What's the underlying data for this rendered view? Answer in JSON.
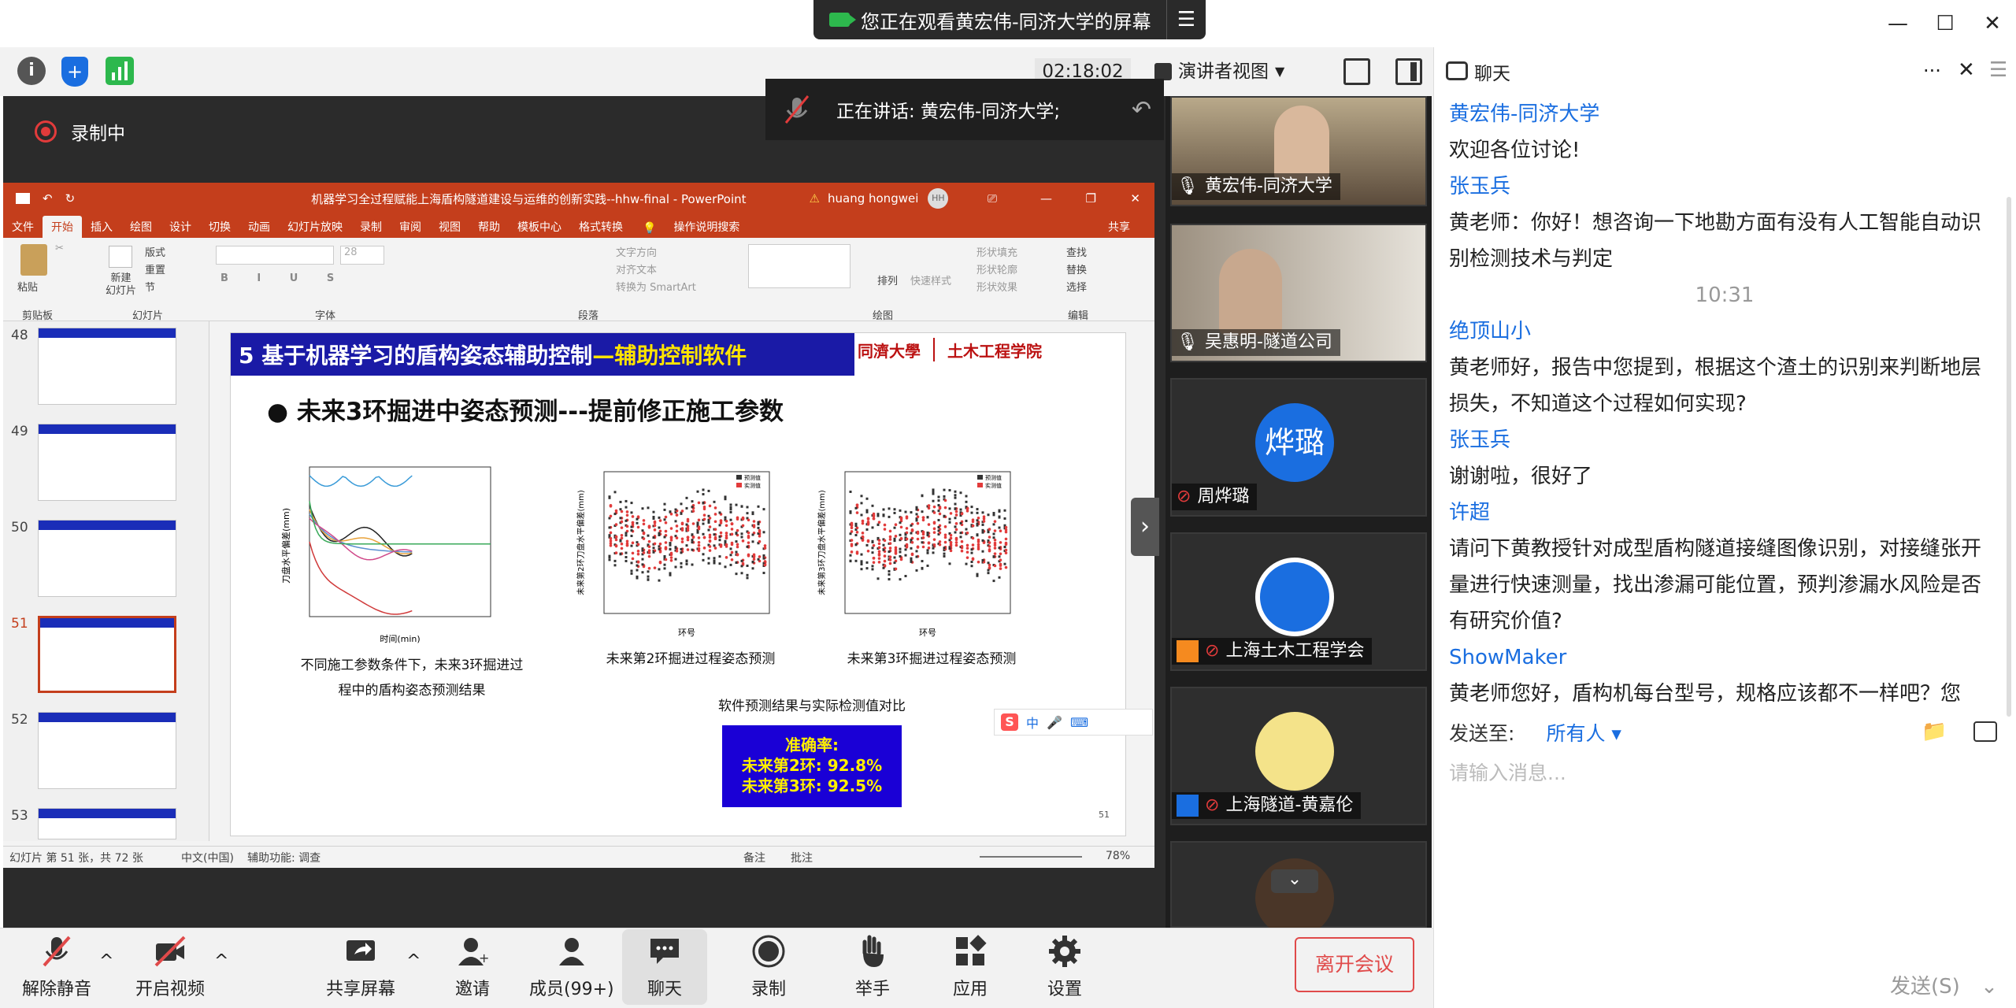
{
  "colors": {
    "accent": "#1a6ee0",
    "leave": "#e04a4a",
    "recording": "#e23b3b",
    "ppt_red": "#c43e1c",
    "slide_blue": "#1a1aa6",
    "highlight": "#ffe400"
  },
  "titlebar": {
    "share_notice": "您正在观看黄宏伟-同济大学的屏幕",
    "menu_icon": "menu-icon"
  },
  "toolbar": {
    "timer": "02:18:02",
    "presenter_view": "演讲者视图"
  },
  "stage": {
    "recording": "录制中",
    "speaking": "正在讲话: 黄宏伟-同济大学;"
  },
  "ppt": {
    "title": "机器学习全过程赋能上海盾构隧道建设与运维的创新实践--hhw-final  -  PowerPoint",
    "user": "huang hongwei",
    "user_initials": "HH",
    "warning": "⚠",
    "tabs": [
      "文件",
      "开始",
      "插入",
      "绘图",
      "设计",
      "切换",
      "动画",
      "幻灯片放映",
      "录制",
      "审阅",
      "视图",
      "帮助",
      "模板中心",
      "格式转换"
    ],
    "tell_me": "操作说明搜索",
    "share": "共享",
    "ribbon_groups": [
      "剪贴板",
      "幻灯片",
      "字体",
      "段落",
      "绘图",
      "编辑"
    ],
    "ribbon_items": {
      "paste": "粘贴",
      "new_slide": "新建\n幻灯片",
      "layout": "版式",
      "reset": "重置",
      "section": "节",
      "font_size": "28",
      "text_dir": "文字方向",
      "align_text": "对齐文本",
      "smartart": "转换为 SmartArt",
      "arrange": "排列",
      "quick_styles": "快速样式",
      "shape_fill": "形状填充",
      "shape_outline": "形状轮廓",
      "shape_effect": "形状效果",
      "find": "查找",
      "replace": "替换",
      "select": "选择"
    },
    "thumb_numbers": [
      "48",
      "49",
      "50",
      "51",
      "52",
      "53"
    ],
    "status": {
      "slide_info": "幻灯片 第 51 张，共 72 张",
      "lang": "中文(中国)",
      "accessibility": "辅助功能: 调查",
      "notes": "备注",
      "comments": "批注",
      "zoom": "78%"
    }
  },
  "slide": {
    "heading_main": "5 基于机器学习的盾构姿态辅助控制",
    "heading_sub": "—辅助控制软件",
    "logo_tongji": "同濟大學",
    "logo_civil": "土木工程学院",
    "bullet": "● 未来3环掘进中姿态预测---提前修正施工参数",
    "caption1": "不同施工参数条件下，未来3环掘进过\n程中的盾构姿态预测结果",
    "caption2": "未来第2环掘进过程姿态预测",
    "caption3": "未来第3环掘进过程姿态预测",
    "compare_title": "软件预测结果与实际检测值对比",
    "accuracy_title": "准确率:",
    "accuracy_ring2": "未来第2环:  92.8%",
    "accuracy_ring3": "未来第3环:  92.5%",
    "page": "51"
  },
  "chart_data": [
    {
      "type": "line",
      "xlabel": "时间(min)",
      "ylabel": "刀盘水平偏差(mm)",
      "xlim": [
        0,
        300
      ],
      "ylim": [
        -3,
        4
      ]
    },
    {
      "type": "scatter",
      "xlabel": "环号",
      "ylabel": "未来第2环刀盘水平偏差(mm)",
      "legend": [
        "预测值",
        "实测值"
      ],
      "xlim": [
        100,
        130
      ],
      "ylim": [
        -20,
        25
      ]
    },
    {
      "type": "scatter",
      "xlabel": "环号",
      "ylabel": "未来第3环刀盘水平偏差(mm)",
      "legend": [
        "预测值",
        "实测值"
      ],
      "xlim": [
        100,
        130
      ],
      "ylim": [
        -20,
        25
      ]
    }
  ],
  "participants": [
    {
      "name": "黄宏伟-同济大学",
      "mic": "mic-icon"
    },
    {
      "name": "吴惠明-隧道公司",
      "mic": "mic-icon"
    },
    {
      "name": "周烨璐",
      "avatar_text": "烨璐",
      "mic": "mic-muted-icon"
    },
    {
      "name": "上海土木工程学会",
      "mic": "mic-muted-icon"
    },
    {
      "name": "上海隧道-黄嘉伦",
      "mic": "mic-muted-icon"
    }
  ],
  "chat": {
    "title": "聊天",
    "messages": [
      {
        "sender": "黄宏伟-同济大学",
        "text": "欢迎各位讨论!"
      },
      {
        "sender": "张玉兵",
        "text": "黄老师：你好！想咨询一下地勘方面有没有人工智能自动识别检测技术与判定"
      },
      {
        "time": "10:31"
      },
      {
        "sender": "绝顶山小",
        "text": "黄老师好，报告中您提到，根据这个渣土的识别来判断地层损失，不知道这个过程如何实现?"
      },
      {
        "sender": "张玉兵",
        "text": "谢谢啦，很好了"
      },
      {
        "sender": "许超",
        "text": "请问下黄教授针对成型盾构隧道接缝图像识别，对接缝张开量进行快速测量，找出渗漏可能位置，预判渗漏水风险是否有研究价值?"
      },
      {
        "sender": "ShowMaker",
        "text": "黄老师您好，盾构机每台型号，规格应该都不一样吧？您"
      }
    ],
    "send_to_label": "发送至:",
    "send_to_value": "所有人",
    "input_placeholder": "请输入消息...",
    "send_button": "发送(S)"
  },
  "bottombar": {
    "unmute": "解除静音",
    "video": "开启视频",
    "share": "共享屏幕",
    "invite": "邀请",
    "members": "成员(99+)",
    "chat": "聊天",
    "record": "录制",
    "raise_hand": "举手",
    "apps": "应用",
    "settings": "设置",
    "leave": "离开会议"
  }
}
